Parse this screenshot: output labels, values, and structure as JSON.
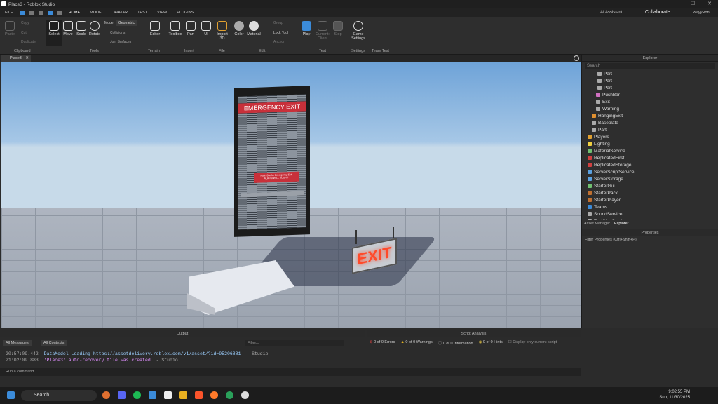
{
  "window": {
    "title": "Place3 - Roblox Studio",
    "controls": [
      "—",
      "☐",
      "✕"
    ]
  },
  "menu": {
    "file": "FILE",
    "tabs": [
      "HOME",
      "MODEL",
      "AVATAR",
      "TEST",
      "VIEW",
      "PLUGINS"
    ],
    "ai": "AI Assistant",
    "collaborate": "Collaborate",
    "user": "WayyRon"
  },
  "ribbon": {
    "clipboard": {
      "paste": "Paste",
      "copy": "Copy",
      "cut": "Cut",
      "duplicate": "Duplicate",
      "label": "Clipboard"
    },
    "tools": {
      "select": "Select",
      "move": "Move",
      "scale": "Scale",
      "rotate": "Rotate",
      "mode_label": "Mode:",
      "mode_value": "Geometric",
      "collisions": "Collisions",
      "join": "Join Surfaces",
      "label": "Tools"
    },
    "terrain": {
      "editor": "Editor",
      "label": "Terrain"
    },
    "insert": {
      "toolbox": "Toolbox",
      "part": "Part",
      "ui": "UI",
      "label": "Insert"
    },
    "file": {
      "import": "Import 3D",
      "label": "File"
    },
    "edit": {
      "color": "Color",
      "material": "Material",
      "group": "Group",
      "lock": "Lock Tool",
      "anchor": "Anchor",
      "label": "Edit"
    },
    "test": {
      "play": "Play",
      "client": "Current: Client",
      "stop": "Stop",
      "label": "Test"
    },
    "settings": {
      "game": "Game Settings",
      "label": "Settings"
    },
    "teamtest": {
      "label": "Team Test"
    }
  },
  "viewport_tab": "Place3",
  "scene": {
    "door_sign": "EMERGENCY EXIT",
    "door_small": "Push Bar for Emergency Exit",
    "door_alarm": "ALARM WILL SOUND",
    "exit_sign": "EXIT"
  },
  "explorer": {
    "title": "Explorer",
    "search_placeholder": "Search",
    "items": [
      "Part",
      "Part",
      "Part",
      "PushBar",
      "Exit",
      "Warning",
      "HangingExit",
      "Baseplate",
      "Part",
      "Players",
      "Lighting",
      "MaterialService",
      "ReplicatedFirst",
      "ReplicatedStorage",
      "ServerScriptService",
      "ServerStorage",
      "StarterGui",
      "StarterPack",
      "StarterPlayer",
      "Teams",
      "SoundService",
      "TextChatService"
    ],
    "tabs": [
      "Asset Manager",
      "Explorer"
    ]
  },
  "properties": {
    "title": "Properties",
    "filter": "Filter Properties (Ctrl+Shift+P)"
  },
  "output": {
    "title": "Output",
    "filter1": "All Messages",
    "filter2": "All Contexts",
    "filter_placeholder": "Filter...",
    "lines": [
      {
        "time": "20:57:09.442",
        "text": "DataModel Loading https://assetdelivery.roblox.com/v1/asset/?id=95206881",
        "src": "- Studio"
      },
      {
        "time": "21:02:09.883",
        "text": "'Place3' auto-recovery file was created",
        "src": "- Studio"
      }
    ]
  },
  "script_analysis": {
    "title": "Script Analysis",
    "errors": "0 of 0 Errors",
    "warnings": "0 of 0 Warnings",
    "info": "0 of 0 Information",
    "hints": "0 of 0 Hints",
    "checkbox": "Display only current script"
  },
  "command": "Run a command",
  "taskbar": {
    "search": "Search",
    "time": "9:02:55 PM",
    "date": "Sun, 11/30/2025"
  },
  "colors": {
    "accent": "#3b8bd9",
    "sign_red": "#c8303a",
    "exit_glow": "#ff4a2a"
  }
}
